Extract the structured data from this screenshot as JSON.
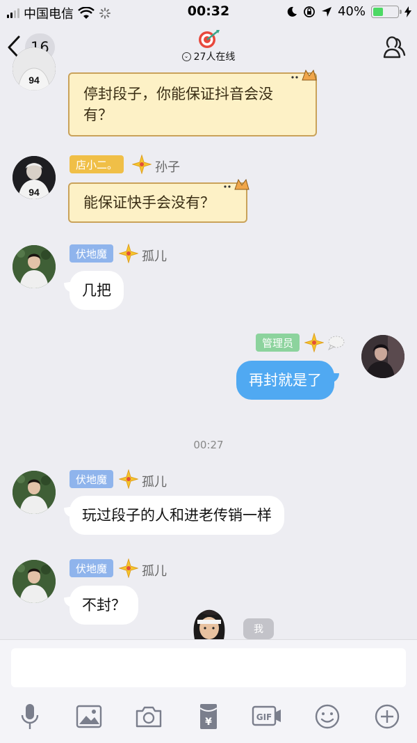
{
  "status_bar": {
    "carrier": "中国电信",
    "time": "00:32",
    "battery_percent": "40%",
    "battery_level": 0.4
  },
  "header": {
    "back_count": "16",
    "online_text": "27人在线"
  },
  "messages": [
    {
      "side": "left",
      "text": "停封段子，你能保证抖音会没有？",
      "style": "scroll"
    },
    {
      "side": "left",
      "tag": "店小二。",
      "name": "孙子",
      "text": "能保证快手会没有？",
      "style": "scroll"
    },
    {
      "side": "left",
      "tag": "伏地魔",
      "name": "孤儿",
      "text": "几把"
    },
    {
      "side": "right",
      "tag": "管理员",
      "text": "再封就是了"
    },
    {
      "side": "left",
      "tag": "伏地魔",
      "name": "孤儿",
      "text": "玩过段子的人和进老传销一样"
    },
    {
      "side": "left",
      "tag": "伏地魔",
      "name": "孤儿",
      "text": "不封？"
    }
  ],
  "timestamp": "00:27",
  "me_label": "我",
  "toolbar": {
    "icons": [
      "microphone-icon",
      "image-icon",
      "camera-icon",
      "red-packet-icon",
      "gif-icon",
      "emoji-icon",
      "plus-icon"
    ]
  }
}
